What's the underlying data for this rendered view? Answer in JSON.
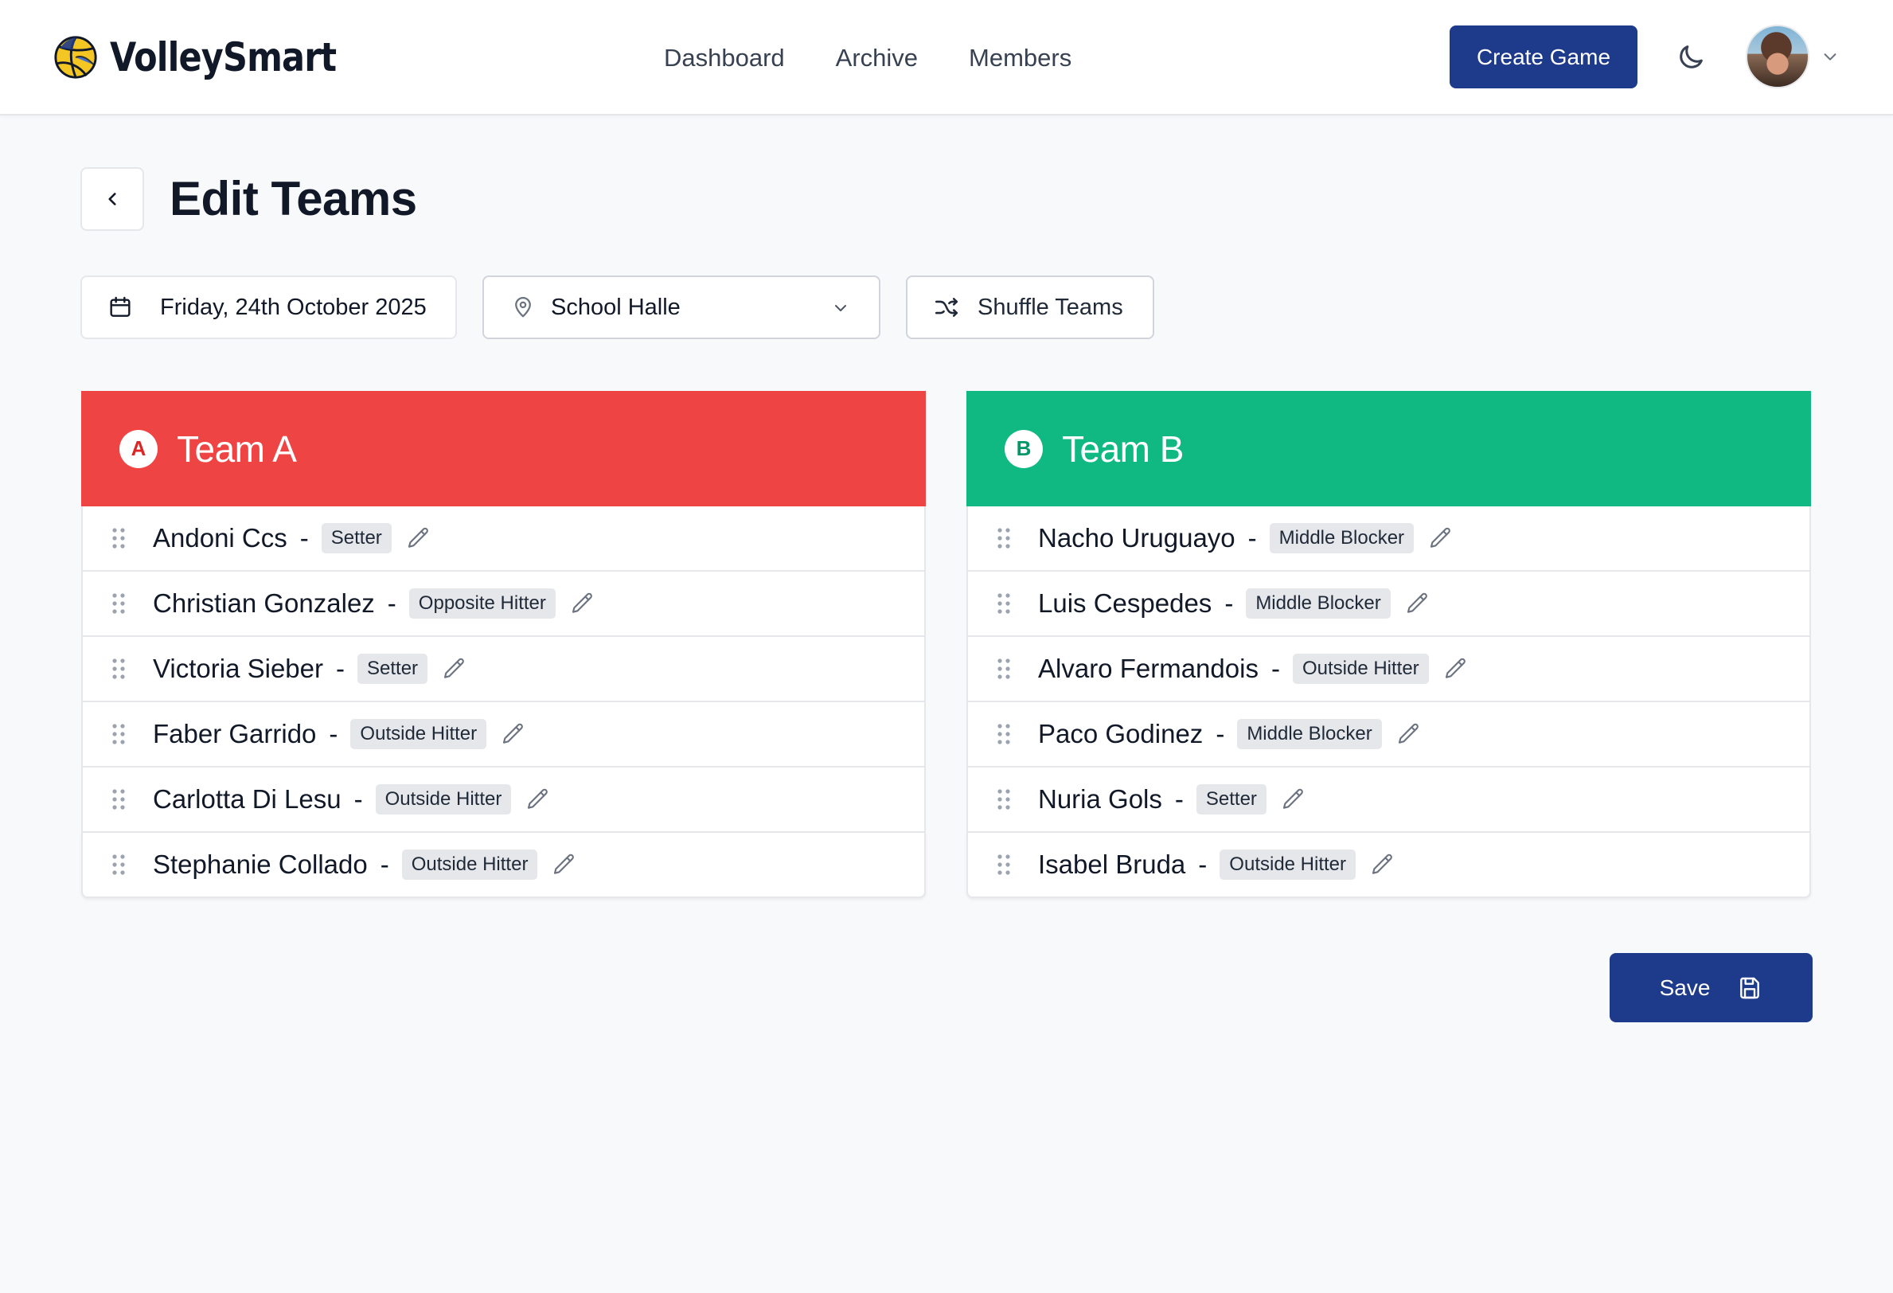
{
  "header": {
    "brand": "VolleySmart",
    "nav": [
      "Dashboard",
      "Archive",
      "Members"
    ],
    "create_label": "Create Game"
  },
  "page": {
    "title": "Edit Teams"
  },
  "controls": {
    "date": "Friday, 24th October 2025",
    "location": "School Halle",
    "shuffle_label": "Shuffle Teams"
  },
  "teams": [
    {
      "badge": "A",
      "name": "Team A",
      "color": "#ef4444",
      "players": [
        {
          "name": "Andoni Ccs",
          "role": "Setter"
        },
        {
          "name": "Christian Gonzalez",
          "role": "Opposite Hitter"
        },
        {
          "name": "Victoria Sieber",
          "role": "Setter"
        },
        {
          "name": "Faber Garrido",
          "role": "Outside Hitter"
        },
        {
          "name": "Carlotta Di Lesu",
          "role": "Outside Hitter"
        },
        {
          "name": "Stephanie Collado",
          "role": "Outside Hitter"
        }
      ]
    },
    {
      "badge": "B",
      "name": "Team B",
      "color": "#10b981",
      "players": [
        {
          "name": "Nacho Uruguayo",
          "role": "Middle Blocker"
        },
        {
          "name": "Luis Cespedes",
          "role": "Middle Blocker"
        },
        {
          "name": "Alvaro Fermandois",
          "role": "Outside Hitter"
        },
        {
          "name": "Paco Godinez",
          "role": "Middle Blocker"
        },
        {
          "name": "Nuria Gols",
          "role": "Setter"
        },
        {
          "name": "Isabel Bruda",
          "role": "Outside Hitter"
        }
      ]
    }
  ],
  "footer": {
    "save_label": "Save"
  },
  "icons": {
    "calendar": "calendar-icon",
    "location": "map-pin-icon",
    "shuffle": "shuffle-icon",
    "theme": "moon-icon",
    "back": "chevron-left-icon",
    "drag": "grip-vertical-icon",
    "edit": "pencil-icon",
    "save": "save-icon"
  },
  "colors": {
    "primary": "#1e3a8a",
    "team_a": "#ef4444",
    "team_b": "#10b981",
    "background": "#f8f9fb"
  }
}
